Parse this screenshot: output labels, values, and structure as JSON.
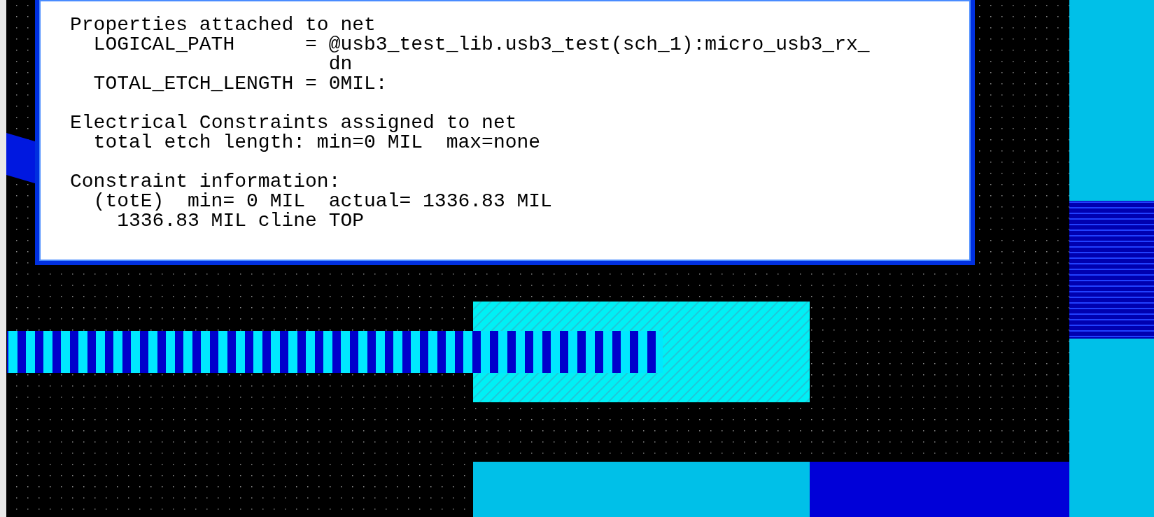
{
  "info_popup": {
    "sections": [
      {
        "title": "Properties attached to net",
        "items": [
          {
            "kind": "property",
            "label": "LOGICAL_PATH",
            "value": "= @usb3_test_lib.usb3_test(sch_1):micro_usb3_rx_",
            "continuation": "dn"
          },
          {
            "kind": "property",
            "label": "TOTAL_ETCH_LENGTH",
            "value": "= 0MIL:"
          }
        ]
      },
      {
        "title": "Electrical Constraints assigned to net",
        "items": [
          {
            "kind": "text",
            "text": "total etch length: min=0 MIL  max=none"
          }
        ]
      },
      {
        "title": "Constraint information:",
        "items": [
          {
            "kind": "text",
            "text": "(totE)  min= 0 MIL  actual= 1336.83 MIL",
            "children": [
              {
                "kind": "text",
                "text": "1336.83 MIL cline TOP"
              }
            ]
          }
        ]
      }
    ]
  }
}
